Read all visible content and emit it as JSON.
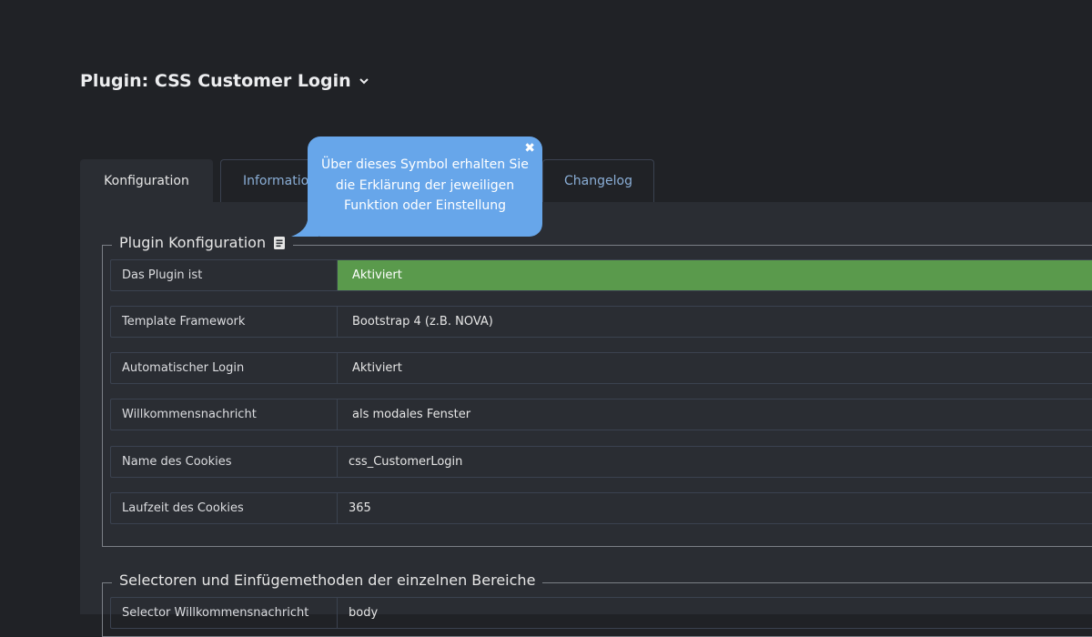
{
  "header": {
    "title": "Plugin: CSS Customer Login",
    "dropdown_icon": "chevron-down-icon"
  },
  "tabs": [
    {
      "label": "Konfiguration",
      "active": true
    },
    {
      "label": "Informationen",
      "active": false
    },
    {
      "label": "Changelog",
      "active": false
    }
  ],
  "tooltip": {
    "lines": [
      "Über dieses Symbol erhalten Sie",
      "die Erklärung der jeweiligen",
      "Funktion oder Einstellung"
    ],
    "close_icon": "close-icon",
    "color": "#67a6ea"
  },
  "config": {
    "legend": "Plugin Konfiguration",
    "legend_icon": "book-icon",
    "rows": [
      {
        "label": "Das Plugin ist",
        "value": "Aktiviert"
      },
      {
        "label": "Template Framework",
        "value": "Bootstrap 4 (z.B. NOVA)"
      },
      {
        "label": "Automatischer Login",
        "value": "Aktiviert"
      },
      {
        "label": "Willkommensnachricht",
        "value": "als modales Fenster"
      },
      {
        "label": "Name des Cookies",
        "value": "css_CustomerLogin"
      },
      {
        "label": "Laufzeit des Cookies",
        "value": "365"
      }
    ]
  },
  "selectors": {
    "legend": "Selectoren und Einfügemethoden der einzelnen Bereiche",
    "rows": [
      {
        "label": "Selector Willkommensnachricht",
        "value": "body"
      }
    ]
  },
  "colors": {
    "background": "#202226",
    "panel": "#2a2d33",
    "active_status": "#5a9a4c",
    "tab_link": "#8aaed6"
  }
}
